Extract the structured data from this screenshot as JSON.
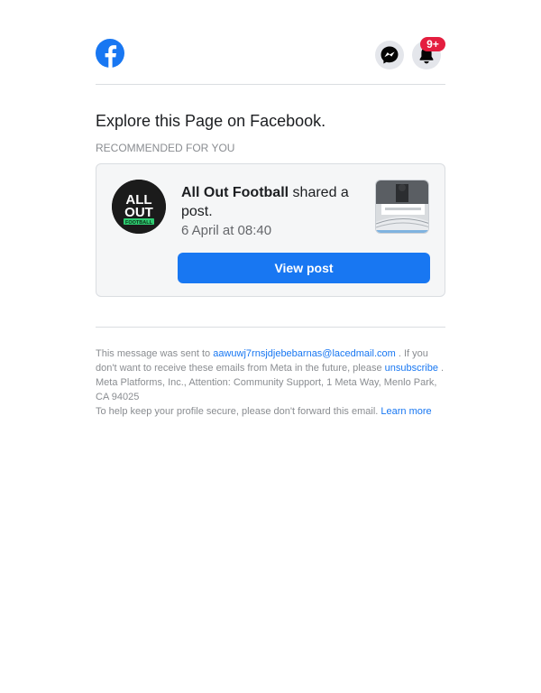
{
  "header": {
    "logo_icon": "facebook-logo-icon",
    "messenger_icon": "messenger-icon",
    "notifications_icon": "bell-icon",
    "notifications_badge": "9+",
    "brand_color": "#1877f2",
    "badge_color": "#e41e3f"
  },
  "headline": "Explore this Page on Facebook.",
  "section_label": "RECOMMENDED FOR YOU",
  "card": {
    "page_name": "All Out Football",
    "action_text": " shared a post.",
    "timestamp": "6 April at 08:40",
    "avatar_icon": "all-out-football-logo",
    "avatar_line1": "ALL",
    "avatar_line2": "OUT",
    "avatar_tag": "FOOTBALL",
    "thumbnail_icon": "post-thumbnail-image",
    "button_label": "View post"
  },
  "footer": {
    "sent_to_prefix": "This message was sent to ",
    "email": "aawuwj7rnsjdjebebarnas@lacedmail.com",
    "sent_to_suffix": " . If you don't want to receive these emails from Meta in the future, please ",
    "unsubscribe_label": "unsubscribe",
    "address": " . Meta Platforms, Inc., Attention: Community Support, 1 Meta Way, Menlo Park, CA 94025",
    "secure_note": "To help keep your profile secure, please don't forward this email. ",
    "learn_more_label": "Learn more"
  }
}
